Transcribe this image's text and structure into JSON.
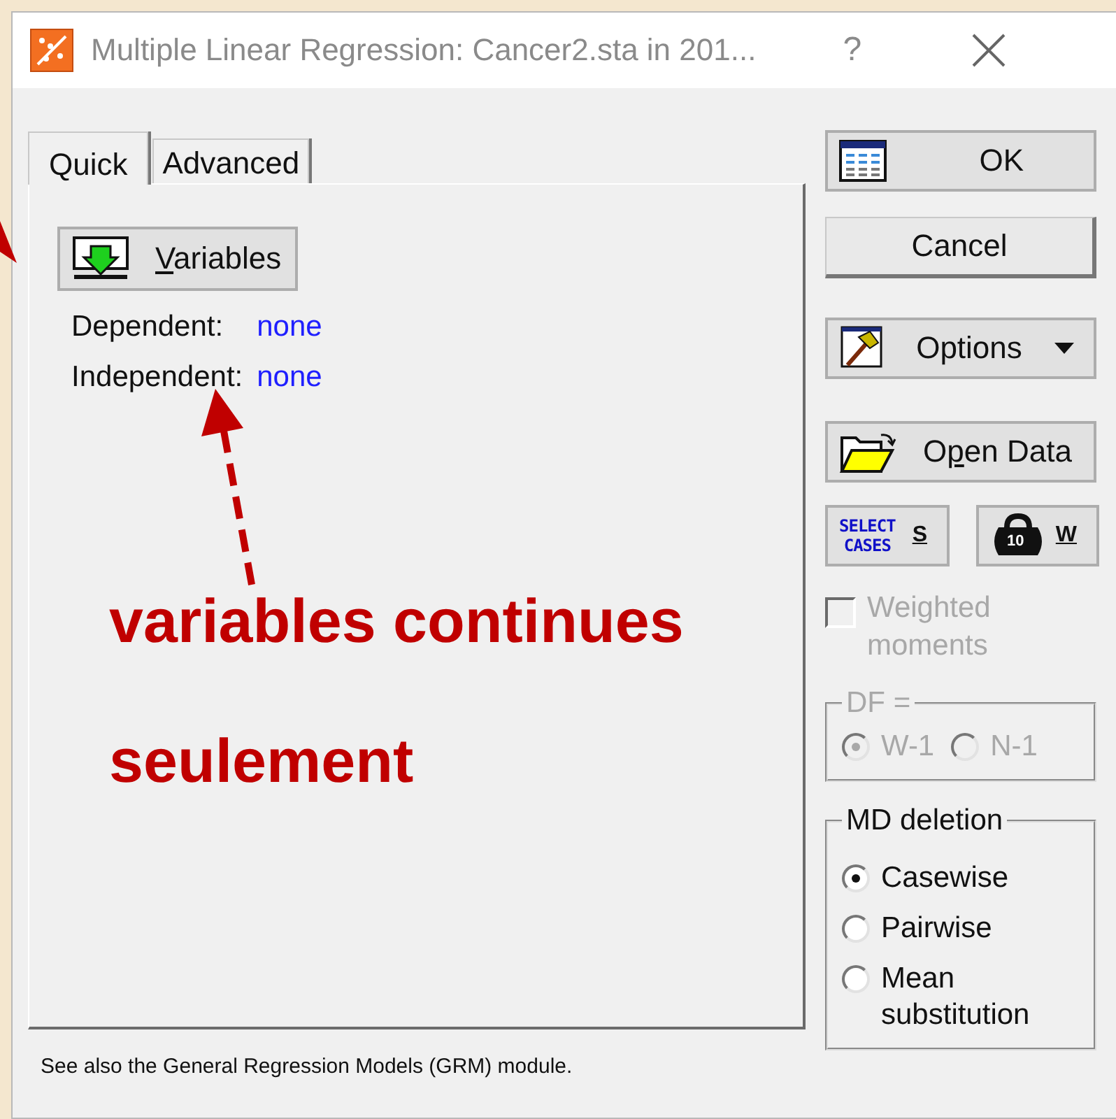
{
  "window": {
    "title": "Multiple Linear Regression: Cancer2.sta in 201...",
    "help": "?"
  },
  "tabs": [
    {
      "label": "Quick",
      "selected": true
    },
    {
      "label": "Advanced",
      "selected": false
    }
  ],
  "variables_button": {
    "access_key": "V",
    "label_after": "ariables"
  },
  "fields": [
    {
      "label": "Dependent:",
      "value": "none"
    },
    {
      "label": "Independent:",
      "value": "none"
    }
  ],
  "ok_button": {
    "label": "OK"
  },
  "cancel_button": {
    "label": "Cancel"
  },
  "options_button": {
    "label": "Options"
  },
  "open_data_button": {
    "label_before": "O",
    "access_key": "p",
    "label_after": "en Data"
  },
  "select_cases_button": {
    "icon_text": [
      "SELECT",
      "CASES"
    ],
    "label": "S"
  },
  "weight_button": {
    "icon_text": "10",
    "label": "W"
  },
  "weighted_moments": {
    "label": "Weighted moments",
    "checked": false,
    "disabled": true
  },
  "df_group": {
    "title": "DF =",
    "disabled": true,
    "options": [
      {
        "label": "W-1",
        "selected": true
      },
      {
        "label": "N-1",
        "selected": false
      }
    ]
  },
  "md_group": {
    "title": "MD deletion",
    "disabled": false,
    "options": [
      {
        "label": "Casewise",
        "selected": true
      },
      {
        "label": "Pairwise",
        "selected": false
      },
      {
        "label": "Mean substitution",
        "selected": false
      }
    ]
  },
  "status": "See also the General Regression Models (GRM) module.",
  "annotation": {
    "lines": [
      "variables continues",
      "seulement"
    ]
  }
}
